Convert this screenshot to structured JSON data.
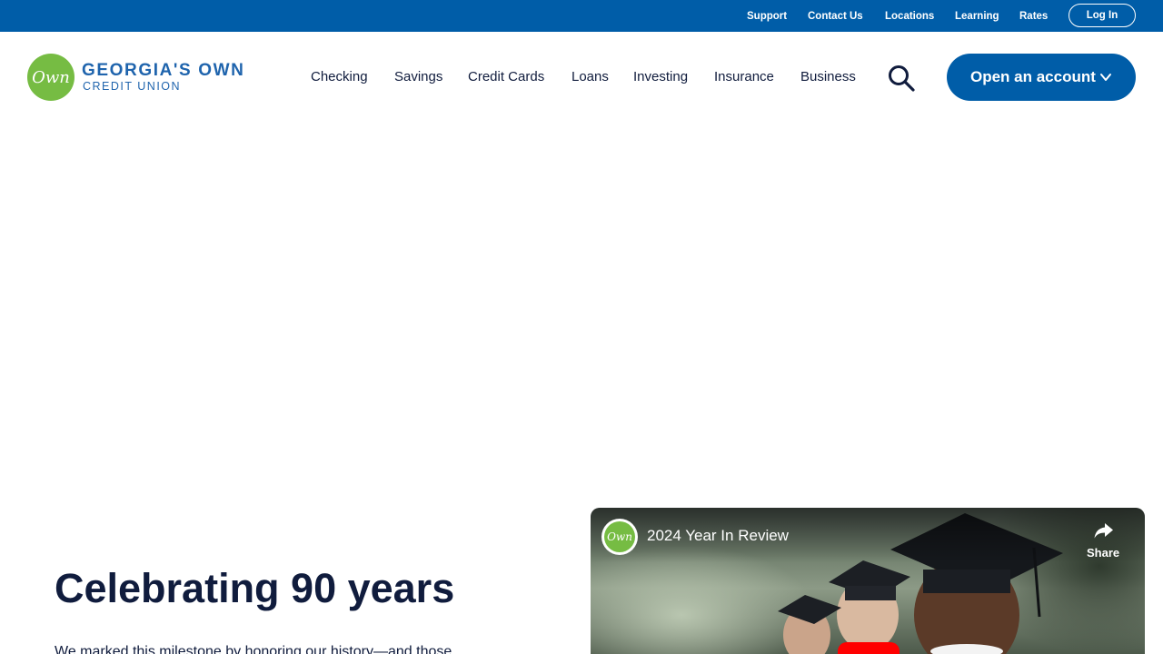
{
  "utility_nav": {
    "links": [
      "Support",
      "Contact Us",
      "Locations",
      "Learning",
      "Rates"
    ],
    "login_label": "Log In"
  },
  "logo": {
    "mark": "Own",
    "name": "GEORGIA'S OWN",
    "subtitle": "CREDIT UNION"
  },
  "main_nav": {
    "links": [
      "Checking",
      "Savings",
      "Credit Cards",
      "Loans",
      "Investing",
      "Insurance",
      "Business"
    ],
    "search_icon": "search-icon",
    "open_account_label": "Open an account"
  },
  "hero": {
    "headline": "Celebrating 90 years",
    "body": "We marked this milestone by honoring our history—and those"
  },
  "video": {
    "channel_mark": "Own",
    "title": "2024 Year In Review",
    "share_label": "Share"
  },
  "colors": {
    "brand_blue": "#005da8",
    "brand_green": "#76bc43",
    "text_navy": "#101c3d"
  }
}
